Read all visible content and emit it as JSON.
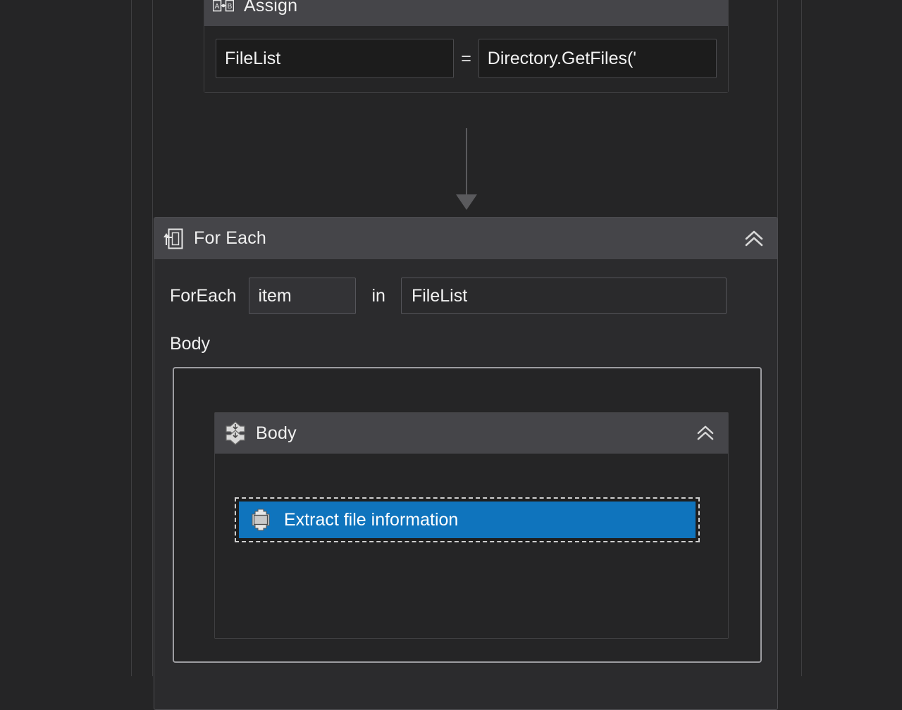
{
  "canvas": {
    "background": "#252526",
    "panel_background": "#2d2d30",
    "header_background": "#454549",
    "selection_color": "#0f74bd",
    "border_color": "#3f3f41"
  },
  "assign": {
    "title": "Assign",
    "icon": "assign-ab-icon",
    "to_value": "FileList",
    "operator": "=",
    "value_expression": "Directory.GetFiles('"
  },
  "connector": {
    "icon": "arrow-down-icon"
  },
  "for_each": {
    "title": "For Each",
    "icon": "loop-icon",
    "collapse_icon": "double-chevron-up-icon",
    "prefix_label": "ForEach",
    "iterator_variable": "item",
    "in_label": "in",
    "collection_value": "FileList",
    "body_label": "Body",
    "body": {
      "sequence": {
        "title": "Body",
        "icon": "sequence-icon",
        "collapse_icon": "double-chevron-up-icon",
        "children": [
          {
            "title": "Extract file information",
            "icon": "sequence-activity-icon",
            "selected": true
          }
        ]
      }
    }
  }
}
